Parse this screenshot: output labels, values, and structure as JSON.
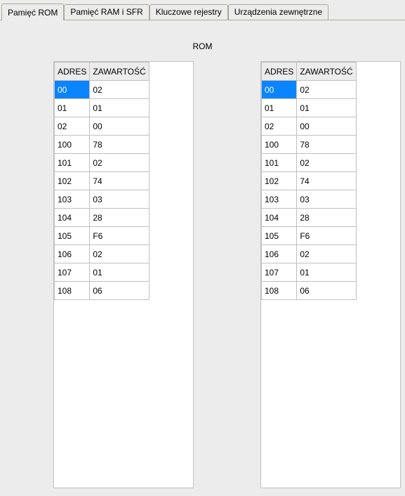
{
  "tabs": {
    "items": [
      {
        "label": "Pamięć ROM",
        "active": true
      },
      {
        "label": "Pamięć RAM i SFR",
        "active": false
      },
      {
        "label": "Kluczowe rejestry",
        "active": false
      },
      {
        "label": "Urządzenia zewnętrzne",
        "active": false
      }
    ]
  },
  "title": "ROM",
  "columns": {
    "address": "ADRES",
    "value": "ZAWARTOŚĆ"
  },
  "left_table": {
    "rows": [
      {
        "addr": "00",
        "val": "02",
        "selected": true
      },
      {
        "addr": "01",
        "val": "01"
      },
      {
        "addr": "02",
        "val": "00"
      },
      {
        "addr": "100",
        "val": "78"
      },
      {
        "addr": "101",
        "val": "02"
      },
      {
        "addr": "102",
        "val": "74"
      },
      {
        "addr": "103",
        "val": "03"
      },
      {
        "addr": "104",
        "val": "28"
      },
      {
        "addr": "105",
        "val": "F6"
      },
      {
        "addr": "106",
        "val": "02"
      },
      {
        "addr": "107",
        "val": "01"
      },
      {
        "addr": "108",
        "val": "06"
      }
    ]
  },
  "right_table": {
    "rows": [
      {
        "addr": "00",
        "val": "02",
        "selected": true
      },
      {
        "addr": "01",
        "val": "01"
      },
      {
        "addr": "02",
        "val": "00"
      },
      {
        "addr": "100",
        "val": "78"
      },
      {
        "addr": "101",
        "val": "02"
      },
      {
        "addr": "102",
        "val": "74"
      },
      {
        "addr": "103",
        "val": "03"
      },
      {
        "addr": "104",
        "val": "28"
      },
      {
        "addr": "105",
        "val": "F6"
      },
      {
        "addr": "106",
        "val": "02"
      },
      {
        "addr": "107",
        "val": "01"
      },
      {
        "addr": "108",
        "val": "06"
      }
    ]
  }
}
